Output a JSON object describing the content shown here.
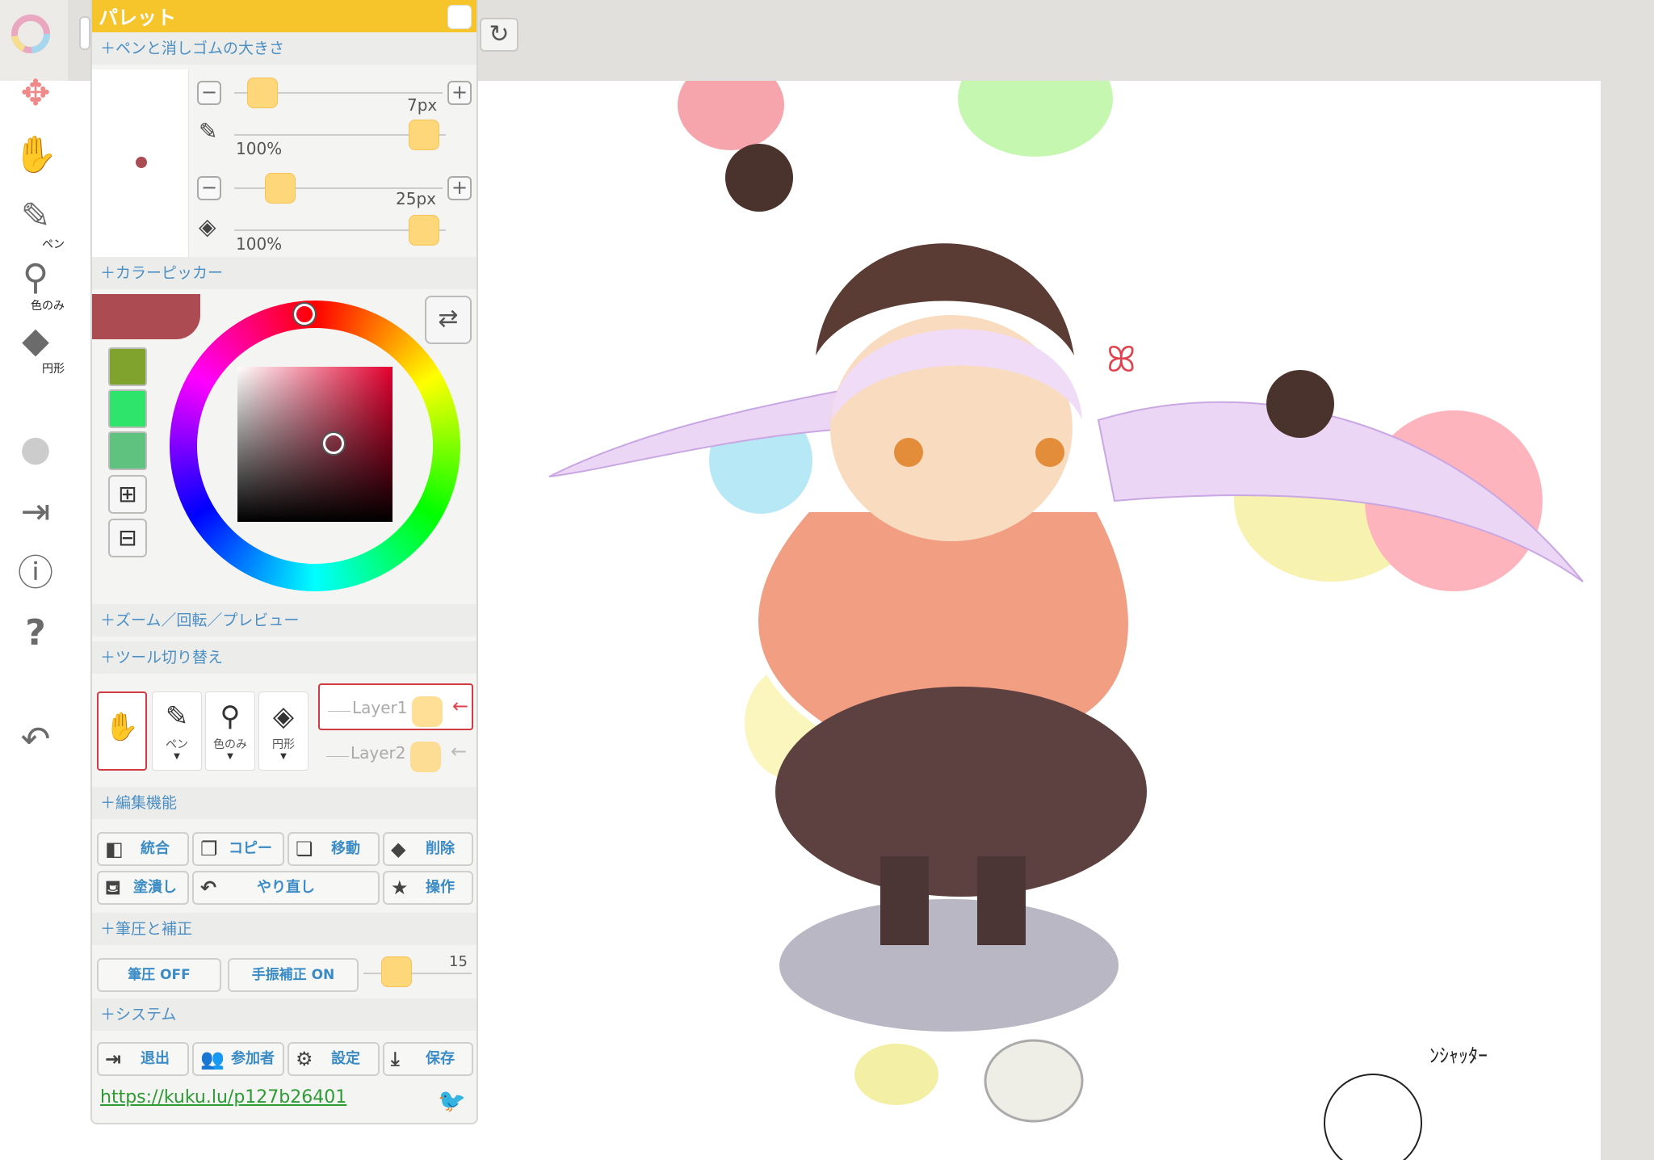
{
  "palette": {
    "title": "パレット",
    "sections": {
      "pen_eraser_size": "＋ペンと消しゴムの大きさ",
      "color_picker": "＋カラーピッカー",
      "zoom": "＋ズーム／回転／プレビュー",
      "tool_switch": "＋ツール切り替え",
      "edit": "＋編集機能",
      "pressure": "＋筆圧と補正",
      "system": "＋システム"
    },
    "pen_size": "7px",
    "pen_opacity": "100%",
    "eraser_size": "25px",
    "eraser_opacity": "100%",
    "brush_color": "#ad4b53",
    "history_colors": [
      "#7fa32d",
      "#2ee46b",
      "#5fc27e"
    ],
    "tools": [
      {
        "label": "",
        "icon": "hand-icon"
      },
      {
        "label": "ペン",
        "icon": "pen-icon"
      },
      {
        "label": "色のみ",
        "icon": "eyedropper-icon"
      },
      {
        "label": "円形",
        "icon": "eraser-icon"
      }
    ],
    "layers": [
      "Layer1",
      "Layer2"
    ],
    "edit_buttons": {
      "merge": "統合",
      "copy": "コピー",
      "move": "移動",
      "delete": "削除",
      "fill": "塗潰し",
      "redo": "やり直し",
      "operation": "操作"
    },
    "pressure_off": "筆圧 OFF",
    "stabilizer_on": "手振補正 ON",
    "stabilizer_value": "15",
    "system_buttons": {
      "exit": "退出",
      "participants": "参加者",
      "settings": "設定",
      "save": "保存"
    },
    "url": "https://kuku.lu/p127b26401"
  },
  "left_toolbar": {
    "pen_label": "ペン",
    "color_only_label": "色のみ",
    "circle_label": "円形"
  },
  "colors": {
    "accent": "#f6c42b",
    "link": "#4c8fc4",
    "knob": "#fed77a"
  }
}
